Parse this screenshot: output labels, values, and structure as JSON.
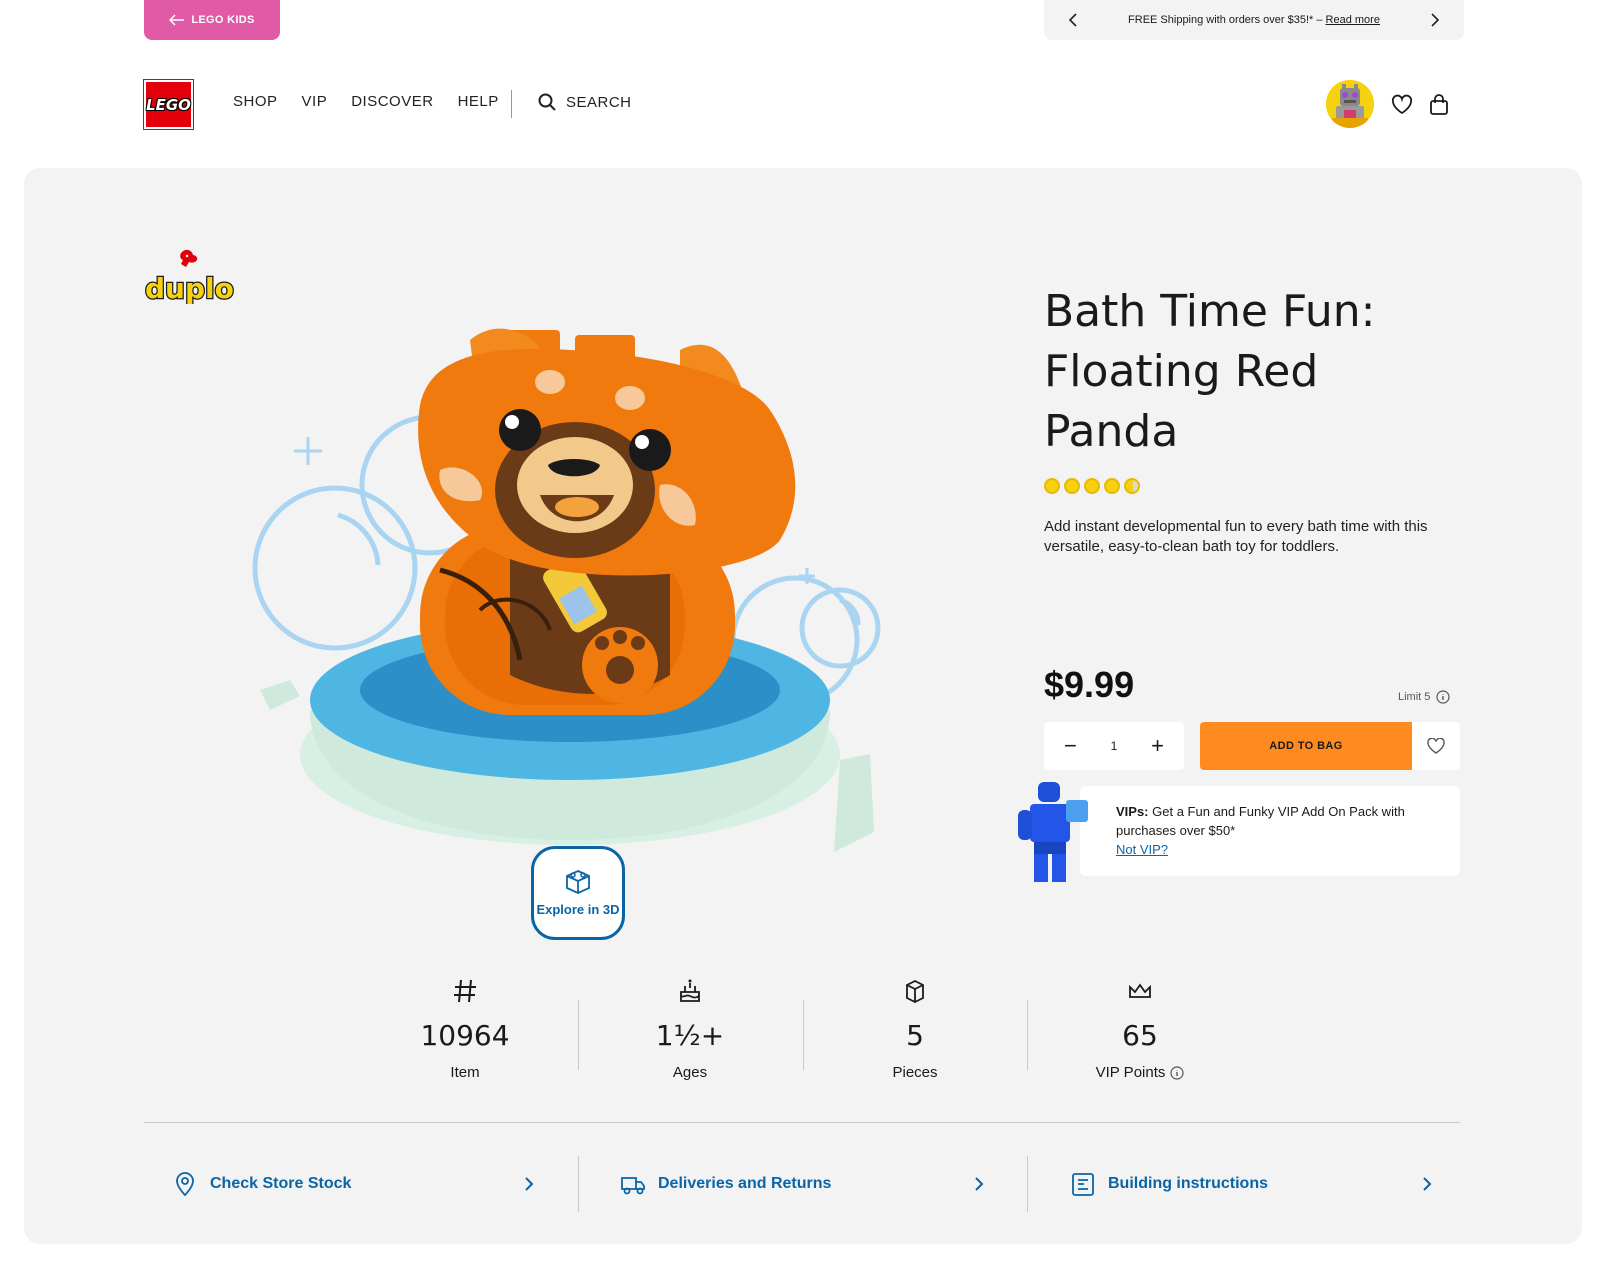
{
  "topbar": {
    "kids_label": "LEGO KIDS",
    "promo_text": "FREE Shipping with orders over $35!* – ",
    "promo_link": "Read more"
  },
  "header": {
    "logo_text": "LEGO",
    "nav": [
      "SHOP",
      "VIP",
      "DISCOVER",
      "HELP"
    ],
    "search_label": "SEARCH"
  },
  "product": {
    "brand": "duplo",
    "title": "Bath Time Fun: Floating Red Panda",
    "rating": 4.6,
    "description": "Add instant developmental fun to every bath time with this versatile, easy-to-clean bath toy for toddlers.",
    "price": "$9.99",
    "limit_text": "Limit 5",
    "quantity": "1",
    "add_to_bag": "ADD TO BAG",
    "explore_label": "Explore in 3D"
  },
  "vip": {
    "prefix": "VIPs:",
    "text": " Get a Fun and Funky VIP Add On Pack with purchases over $50*",
    "link": "Not VIP?"
  },
  "stats": [
    {
      "value": "10964",
      "label": "Item",
      "icon": "hash-icon"
    },
    {
      "value": "1½+",
      "label": "Ages",
      "icon": "cake-icon"
    },
    {
      "value": "5",
      "label": "Pieces",
      "icon": "brick-icon"
    },
    {
      "value": "65",
      "label": "VIP Points",
      "icon": "crown-icon"
    }
  ],
  "links": [
    {
      "label": "Check Store Stock",
      "icon": "location-pin-icon"
    },
    {
      "label": "Deliveries and Returns",
      "icon": "delivery-truck-icon"
    },
    {
      "label": "Building instructions",
      "icon": "instructions-icon"
    }
  ],
  "colors": {
    "accent_pink": "#e05aa6",
    "add_to_bag": "#ff8a1f",
    "link_blue": "#0a65a6",
    "lego_red": "#e3000b",
    "panel_bg": "#f3f3f3"
  }
}
